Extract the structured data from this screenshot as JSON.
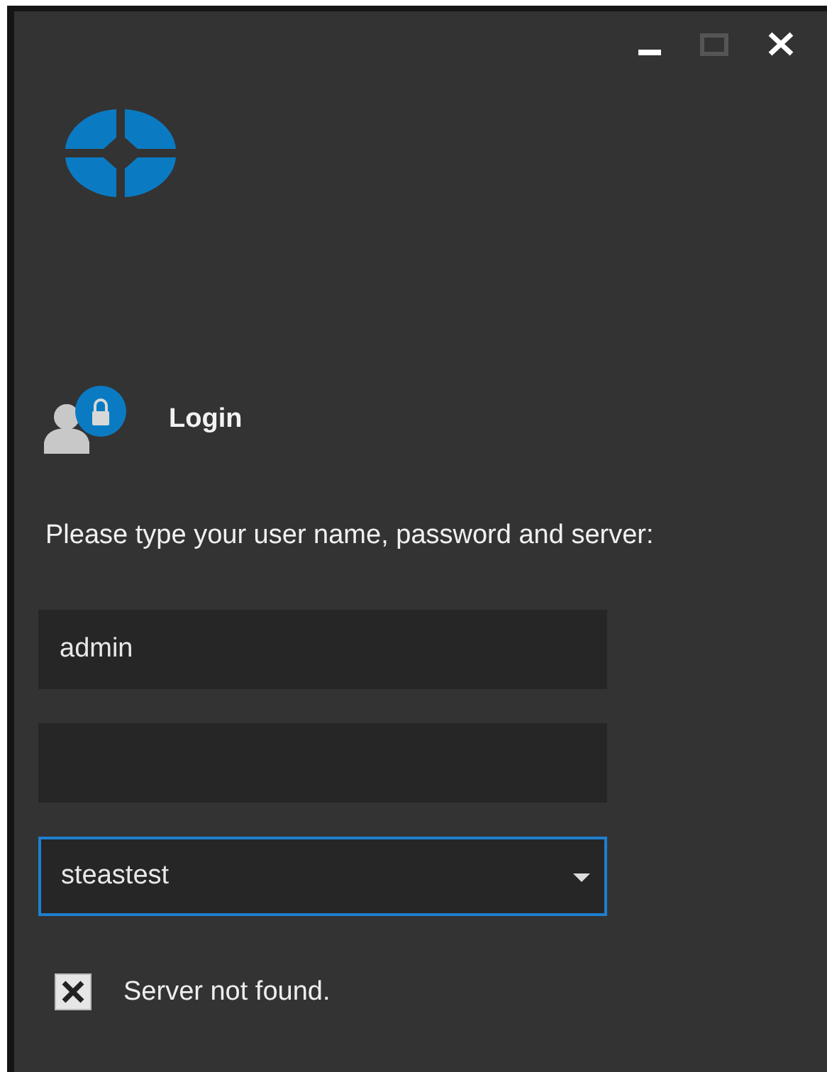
{
  "window": {
    "controls": [
      {
        "kind": "minimize",
        "disabled": false
      },
      {
        "kind": "maximize",
        "disabled": true
      },
      {
        "kind": "close",
        "disabled": false
      }
    ]
  },
  "login": {
    "title": "Login",
    "prompt": "Please type your user name, password and server:"
  },
  "fields": [
    {
      "kind": "text",
      "value": "admin",
      "focused": false
    },
    {
      "kind": "password",
      "focused": false
    },
    {
      "kind": "dropdown",
      "value": "steastest",
      "focused": true
    }
  ],
  "error": {
    "message": "Server not found."
  }
}
